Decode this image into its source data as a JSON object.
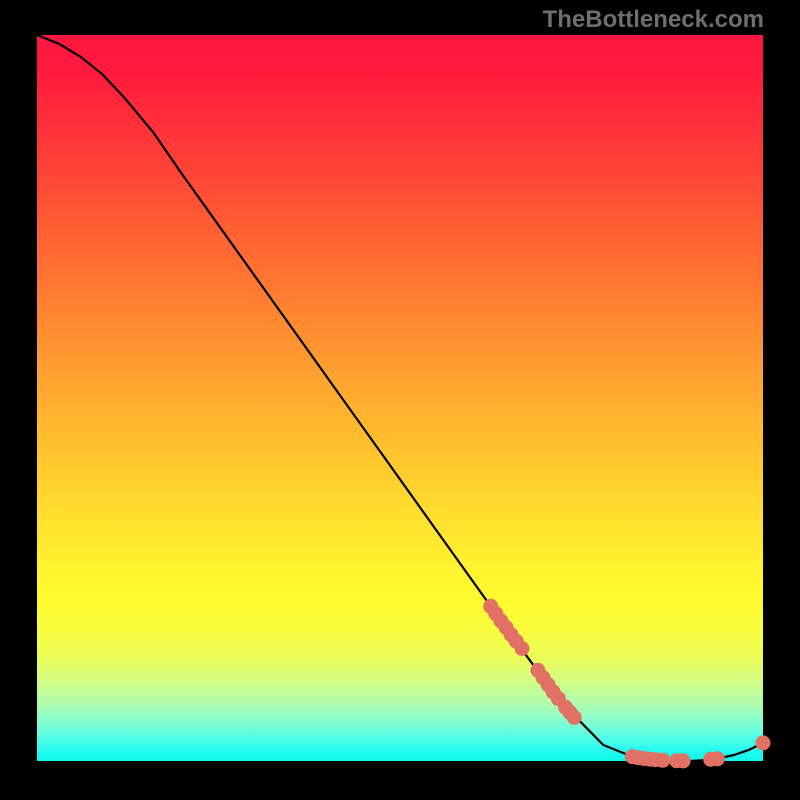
{
  "watermark": "TheBottleneck.com",
  "colors": {
    "dots": "#e07164",
    "curve": "#000000"
  },
  "chart_data": {
    "type": "line",
    "title": "",
    "xlabel": "",
    "ylabel": "",
    "xlim": [
      0,
      100
    ],
    "ylim": [
      0,
      100
    ],
    "grid": false,
    "legend": false,
    "series": [
      {
        "name": "curve",
        "kind": "line",
        "x": [
          0,
          3,
          6,
          9,
          12,
          16,
          20,
          25,
          30,
          36,
          42,
          48,
          54,
          60,
          66,
          72,
          78,
          82,
          85,
          88,
          90,
          92,
          94,
          96,
          98,
          100
        ],
        "y": [
          100,
          98.8,
          97.0,
          94.6,
          91.4,
          86.6,
          80.8,
          73.8,
          66.8,
          58.4,
          50.0,
          41.6,
          33.2,
          24.8,
          16.4,
          8.3,
          2.2,
          0.6,
          0.15,
          0.0,
          0.0,
          0.12,
          0.38,
          0.82,
          1.5,
          2.5
        ]
      },
      {
        "name": "dots",
        "kind": "scatter",
        "x": [
          62.5,
          63.2,
          63.9,
          64.6,
          65.3,
          66.0,
          66.8,
          69.0,
          69.7,
          70.4,
          71.1,
          71.8,
          72.8,
          73.4,
          74.0,
          82.0,
          82.8,
          83.6,
          84.4,
          85.2,
          86.2,
          88.1,
          89.0,
          92.8,
          93.7,
          100.0
        ],
        "y": [
          21.3,
          20.3,
          19.3,
          18.4,
          17.4,
          16.5,
          15.5,
          12.5,
          11.5,
          10.5,
          9.5,
          8.6,
          7.4,
          6.7,
          6.0,
          0.6,
          0.45,
          0.35,
          0.25,
          0.18,
          0.1,
          0.03,
          0.02,
          0.23,
          0.3,
          2.5
        ]
      }
    ]
  }
}
